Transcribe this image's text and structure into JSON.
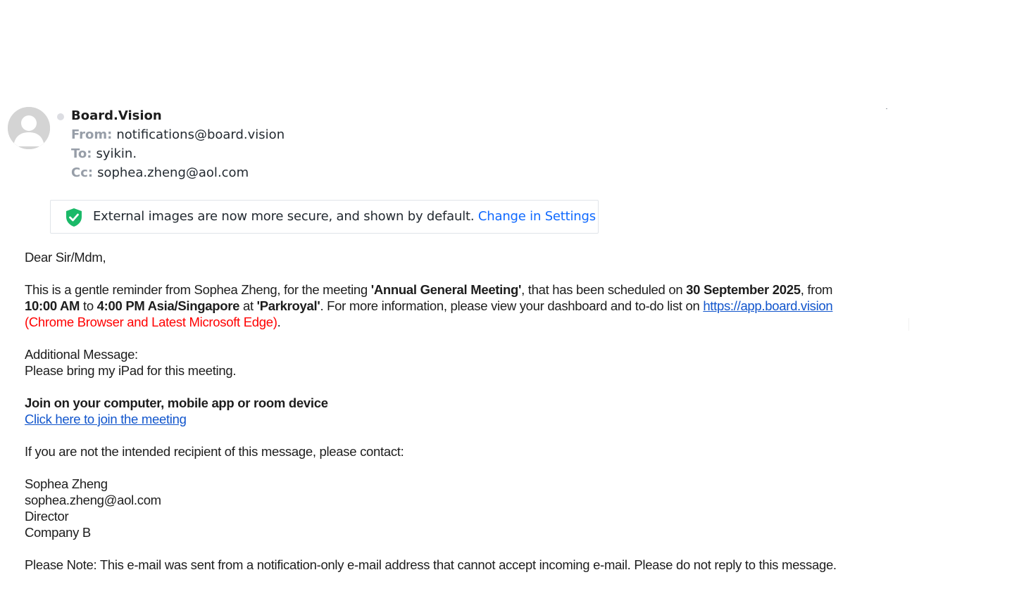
{
  "header": {
    "sender_name": "Board.Vision",
    "from_label": "From:",
    "from_value": "notifications@board.vision",
    "to_label": "To:",
    "to_value": "syikin.",
    "cc_label": "Cc:",
    "cc_value": "sophea.zheng@aol.com"
  },
  "notice": {
    "text": "External images are now more secure, and shown by default.",
    "link_label": "Change in Settings",
    "icon": "shield-check-icon",
    "icon_color": "#1ab968"
  },
  "email": {
    "greeting": "Dear Sir/Mdm,",
    "reminder_intro": "This is a gentle reminder from Sophea Zheng, for the meeting ",
    "meeting_name": "'Annual General Meeting'",
    "scheduled_text": ", that has been scheduled on ",
    "meeting_date": "30 September 2025",
    "from_text": ", from",
    "start_time": "10:00 AM",
    "to_text": " to ",
    "end_time": "4:00 PM Asia/Singapore",
    "at_text": " at ",
    "location": "'Parkroyal'",
    "info_text": ". For more information, please view your dashboard and to-do list on ",
    "dashboard_link": "https://app.board.vision",
    "browser_note": "(Chrome Browser and Latest Microsoft Edge)",
    "browser_note_end": ".",
    "additional_label": "Additional Message:",
    "additional_message": "Please bring my iPad for this meeting.",
    "join_heading": "Join on your computer, mobile app or room device",
    "join_link": "Click here to join the meeting",
    "contact_intro": "If you are not the intended recipient of this message, please contact:",
    "contact_name": "Sophea Zheng",
    "contact_email": "sophea.zheng@aol.com",
    "contact_title": "Director",
    "contact_company": "Company B",
    "footer_note": "Please Note: This e-mail was sent from a notification-only e-mail address that cannot accept incoming e-mail. Please do not reply to this message."
  },
  "colors": {
    "link": "#1155cc",
    "settings_link": "#0f69ff",
    "warning_red": "#ff0000",
    "meta_label": "#979ea8"
  }
}
